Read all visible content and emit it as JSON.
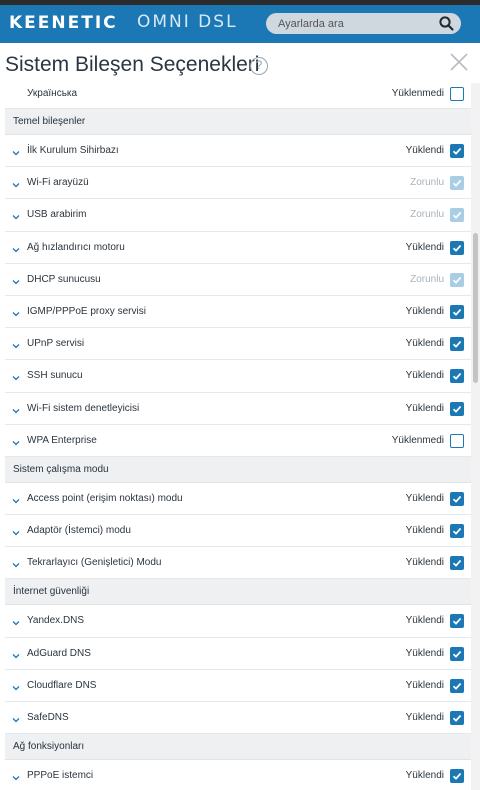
{
  "brand": {
    "logo": "KEENETIC",
    "model": "OMNI DSL",
    "accent": "#1b78b5"
  },
  "search": {
    "placeholder": "Ayarlarda ara"
  },
  "title": "Sistem Bileşen Seçenekleri",
  "help_glyph": "?",
  "top_row": {
    "name": "Українська",
    "status": "Yüklenmedi",
    "state": "off"
  },
  "sections": [
    {
      "title": "Temel bileşenler",
      "items": [
        {
          "name": "İlk Kurulum Sihirbazı",
          "status": "Yüklendi",
          "state": "on"
        },
        {
          "name": "Wi-Fi arayüzü",
          "status": "Zorunlu",
          "state": "required"
        },
        {
          "name": "USB arabirim",
          "status": "Zorunlu",
          "state": "required"
        },
        {
          "name": "Ağ hızlandırıcı motoru",
          "status": "Yüklendi",
          "state": "on"
        },
        {
          "name": "DHCP sunucusu",
          "status": "Zorunlu",
          "state": "required"
        },
        {
          "name": "IGMP/PPPoE proxy servisi",
          "status": "Yüklendi",
          "state": "on"
        },
        {
          "name": "UPnP servisi",
          "status": "Yüklendi",
          "state": "on"
        },
        {
          "name": "SSH sunucu",
          "status": "Yüklendi",
          "state": "on"
        },
        {
          "name": "Wi-Fi sistem denetleyicisi",
          "status": "Yüklendi",
          "state": "on"
        },
        {
          "name": "WPA Enterprise",
          "status": "Yüklenmedi",
          "state": "off"
        }
      ]
    },
    {
      "title": "Sistem çalışma modu",
      "items": [
        {
          "name": "Access point (erişim noktası) modu",
          "status": "Yüklendi",
          "state": "on"
        },
        {
          "name": "Adaptör (İstemci) modu",
          "status": "Yüklendi",
          "state": "on"
        },
        {
          "name": "Tekrarlayıcı (Genişletici) Modu",
          "status": "Yüklendi",
          "state": "on"
        }
      ]
    },
    {
      "title": "İnternet güvenliği",
      "items": [
        {
          "name": "Yandex.DNS",
          "status": "Yüklendi",
          "state": "on"
        },
        {
          "name": "AdGuard DNS",
          "status": "Yüklendi",
          "state": "on"
        },
        {
          "name": "Cloudflare DNS",
          "status": "Yüklendi",
          "state": "on"
        },
        {
          "name": "SafeDNS",
          "status": "Yüklendi",
          "state": "on"
        }
      ]
    },
    {
      "title": "Ağ fonksiyonları",
      "items": [
        {
          "name": "PPPoE istemci",
          "status": "Yüklendi",
          "state": "on"
        }
      ]
    }
  ]
}
